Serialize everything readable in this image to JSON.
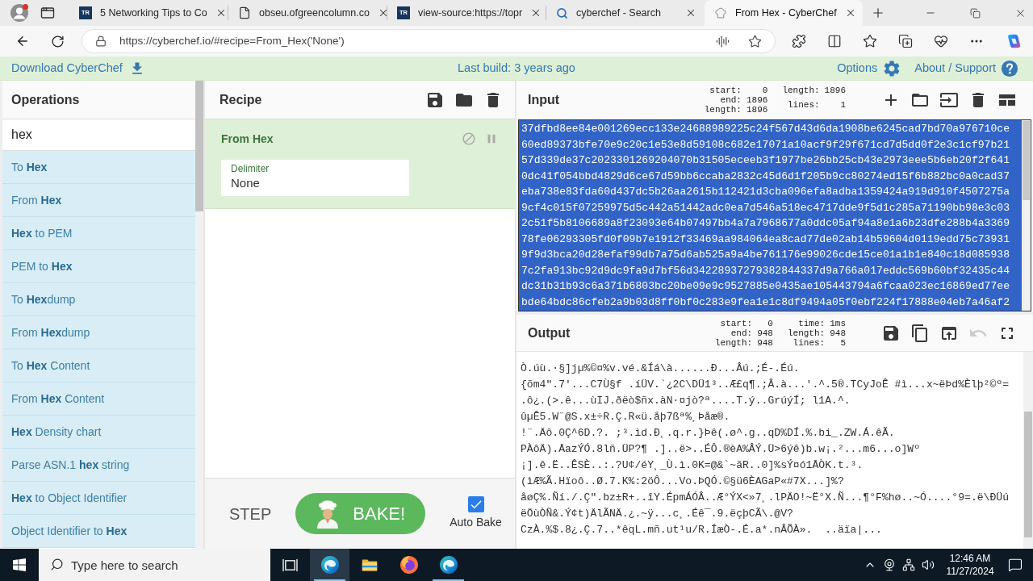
{
  "browser": {
    "tabs": [
      {
        "kind": "logo",
        "logo_text": "TR",
        "title": "5 Networking Tips to Co",
        "selected": false
      },
      {
        "kind": "document",
        "title": "obseu.ofgreencolumn.co",
        "selected": false
      },
      {
        "kind": "logo",
        "logo_text": "TR",
        "title": "view-source:https://topr",
        "selected": false
      },
      {
        "kind": "search",
        "title": "cyberchef - Search",
        "selected": false
      },
      {
        "kind": "chef",
        "title": "From Hex - CyberChef",
        "selected": true
      }
    ],
    "url": "https://cyberchef.io/#recipe=From_Hex('None')"
  },
  "banner": {
    "download": "Download CyberChef",
    "last_build": "Last build: 3 years ago",
    "options": "Options",
    "about": "About / Support"
  },
  "operations": {
    "title": "Operations",
    "search": {
      "value": "hex"
    },
    "items": [
      "To **Hex**",
      "From **Hex**",
      "**Hex** to PEM",
      "PEM to **Hex**",
      "To **Hex**dump",
      "From **Hex**dump",
      "To **Hex** Content",
      "From **Hex** Content",
      "**Hex** Density chart",
      "Parse ASN.1 **hex** string",
      "**Hex** to Object Identifier",
      "Object Identifier to **Hex**"
    ]
  },
  "recipe": {
    "title": "Recipe",
    "operations": [
      {
        "name": "From Hex",
        "disabled": false,
        "breakpoint": false,
        "args": [
          {
            "label": "Delimiter",
            "value": "None"
          }
        ]
      }
    ],
    "step": "STEP",
    "bake": "BAKE!",
    "auto_bake": {
      "label": "Auto Bake",
      "checked": true
    }
  },
  "input": {
    "title": "Input",
    "stats": [
      [
        {
          "label": "start:",
          "value": "0"
        },
        {
          "label": "end:",
          "value": "1896"
        },
        {
          "label": "length:",
          "value": "1896"
        }
      ],
      [
        {
          "label": "length:",
          "value": "1896"
        },
        {
          "label": "lines:",
          "value": "1"
        }
      ]
    ],
    "selected": true,
    "lines": [
      "37dfbd8ee84e001269ecc133e24688989225c24f567d43d6da1908be6245cad7bd70a976710ce",
      "60ed89373bfe70e9c20c1e53e8d59108c682e17071a10acf9f29f671cd7d5dd0f2e3c1cf97b21",
      "57d339de37c2023301269204070b31505eceeb3f1977be26bb25cb43e2973eee5b6eb20f2f641",
      "0dc41f054bbd4829d6ce67d59bb6ccaba2832c45d6d1f205b9cc80274ed15f6b882bc0a0cad37",
      "eba738e83fda60d437dc5b26aa2615b112421d3cba096efa8adba1359424a919d910f4507275a",
      "9cf4c015f07259975d5c442a51442adc0ea7d546a518ec4717dde9f5d1c285a71190bb98e3c03",
      "2c51f5b8106689a8f23093e64b07497bb4a7a7968677a0ddc05af94a8e1a6b23dfe288b4a3369",
      "78fe06293305fd0f09b7e1912f33469aa984064ea8cad77de02ab14b59604d0119edd75c73931",
      "9f9d3bca20d28efaf99db7a75d6ab525a9a4be761176e99026cde15ce01a1b1e840c18d085938",
      "7c2fa913bc92d9dc9fa9d7bf56d34228937279382844337d9a766a017eddc569b60bf32435c44",
      "dc31b31b93c6a371b6803bc20be09e9c9527885e0435ae105443794a6fcaa023ec16869ed77ee",
      "bde64bdc86cfeb2a9b03d8ff0bf0c283e9fea1e1c8df9494a05f0ebf224f17888e04eb7a46af2"
    ]
  },
  "output": {
    "title": "Output",
    "stats": [
      [
        {
          "label": "start:",
          "value": "0"
        },
        {
          "label": "end:",
          "value": "948"
        },
        {
          "label": "length:",
          "value": "948"
        }
      ],
      [
        {
          "label": "time:",
          "value": "1ms"
        },
        {
          "label": "length:",
          "value": "948"
        },
        {
          "label": "lines:",
          "value": "5"
        }
      ]
    ],
    "undo_disabled": true,
    "lines": [
      "Ò.úù.·§]jµ%©¤%v.vé.&Íá\\à......Ð...Âú.;É-.Éú.",
      "{õm4\".7'...C7Ù§f .íÜV.`¿2C\\DÜ1³..Æ£q¶.;Â.à...'.^.5®.TCyJoÊ #ì...x~ëÞd%Èlþ²©º=",
      ".ô¿.(>.ê...ùIJ.ðëò$ñx.àN·¤jò?ª....T.ý..GrúýÍ; l1A.^.",
      "ûµÊ5.W¨@S.x±÷R.Ç.R«ü.åþ7ßª%¸Þåæ®.",
      "!¨.Äô.0Ç^6D.?. ;³.ìd.Ð¸.q.r.}Þê(.ø^.g..qD%DÍ.%.bi_.ZW.Á.êÃ.",
      "PÀôÄ).ÅazÝÓ.8lñ.ÜP?¶ .]..ë>..ÉÔ.®èA%ÂÝ.Ü>6ýê)b.w¡.²...m6...o]Wº",
      "¡].ê.Ë..ÊSÈ..:.?U¢/éY¸_Ù.ì.0K=@&`~ãR..0]%sÝ¤ó1ÅÒK.t.³.",
      "(ìÆ%Ã.Hïoô..Ø.7.K%:2öÔ...Vo.ÞQÓ.©§ü6ÈAGaP«#7X...]%?",
      "åøÇ%.Ñí./.Ç\".bz±R+..îY.ÉpmÁÓÂ..Æ°ÝX<»7¸.lPÄO!~Ë°X.Ñ...¶°F%hø..~Ó....°9=.ë\\ÐÜú",
      "ëÖùÒÑ&.Ý¢t)ÄlÃNÄ.¿.~ÿ...c¸.Éê¯.9.ëçþCÃ\\.@V?",
      "CzÀ.%$.8¿.Ç.7..*êqL.mñ.ut¹u/R.ÍæÒ-.É.a*.nÂÕÀ».  ..äïa|..."
    ]
  },
  "taskbar": {
    "search_placeholder": "Type here to search",
    "apps": [
      {
        "kind": "edge",
        "selected": true,
        "running": true
      },
      {
        "kind": "files",
        "selected": false,
        "running": false
      },
      {
        "kind": "firefox",
        "selected": false,
        "running": false
      },
      {
        "kind": "edge",
        "selected": false,
        "running": true
      }
    ],
    "time": "12:46 AM",
    "date": "11/27/2024"
  }
}
